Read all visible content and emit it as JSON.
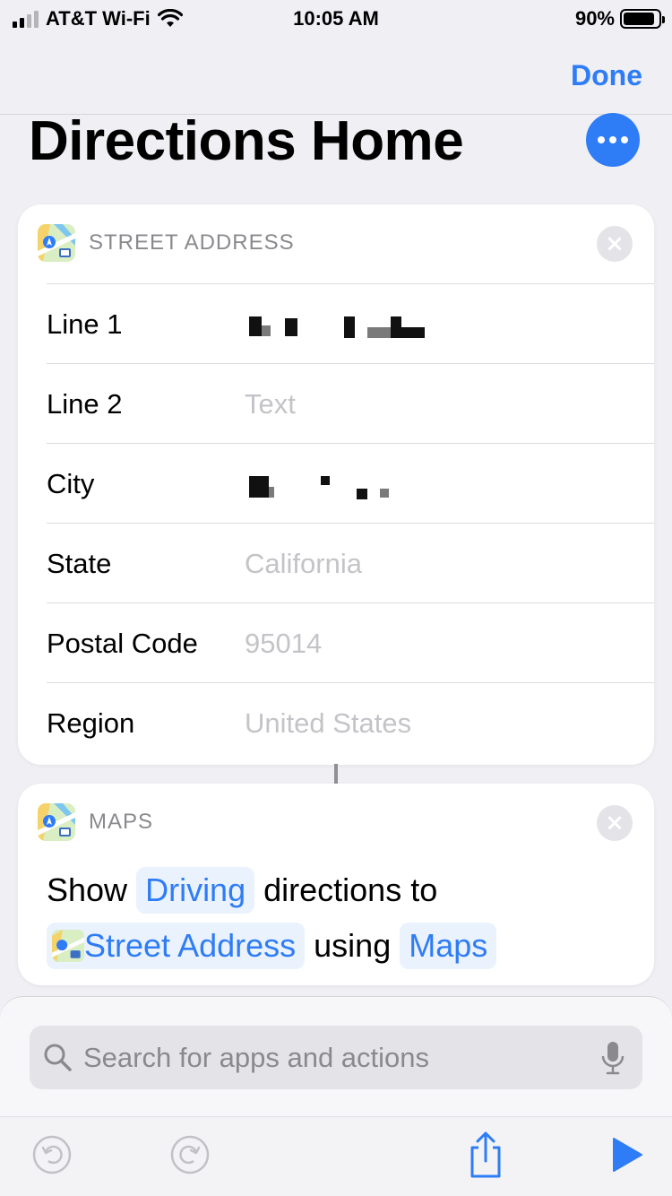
{
  "status_bar": {
    "carrier": "AT&T Wi-Fi",
    "time": "10:05 AM",
    "battery": "90%",
    "battery_level": 0.9
  },
  "nav": {
    "done_label": "Done"
  },
  "shortcut": {
    "title": "Directions Home"
  },
  "address_card": {
    "label": "STREET ADDRESS",
    "rows": [
      {
        "label": "Line 1",
        "value": "",
        "redacted": true
      },
      {
        "label": "Line 2",
        "value": "Text",
        "redacted": false
      },
      {
        "label": "City",
        "value": "",
        "redacted": true
      },
      {
        "label": "State",
        "value": "California",
        "redacted": false
      },
      {
        "label": "Postal Code",
        "value": "95014",
        "redacted": false
      },
      {
        "label": "Region",
        "value": "United States",
        "redacted": false
      }
    ]
  },
  "maps_card": {
    "label": "MAPS",
    "show": "Show",
    "mode": "Driving",
    "directions_to": "directions to",
    "destination": "Street Address",
    "using": "using",
    "app": "Maps"
  },
  "search": {
    "placeholder": "Search for apps and actions"
  },
  "colors": {
    "accent": "#2e7cf6",
    "background": "#efeff4",
    "placeholder": "#c4c4c8"
  },
  "icons": [
    "wifi-icon",
    "battery-icon",
    "more-icon",
    "maps-app-icon",
    "close-icon",
    "search-icon",
    "microphone-icon",
    "undo-icon",
    "redo-icon",
    "share-icon",
    "play-icon"
  ]
}
